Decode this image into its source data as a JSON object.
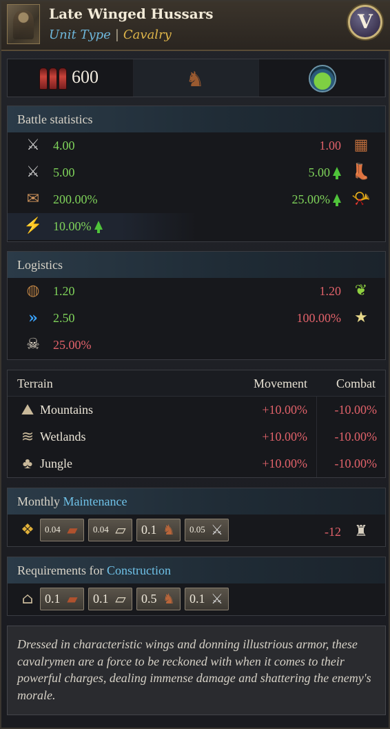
{
  "header": {
    "title": "Late Winged Hussars",
    "unit_type_label": "Unit Type",
    "unit_type_value": "Cavalry",
    "badge": "V"
  },
  "top": {
    "count": "600"
  },
  "battle": {
    "title": "Battle statistics",
    "rows": [
      {
        "left": "4.00",
        "right": "1.00",
        "left_icon": "melee-attack-icon",
        "right_icon": "armor-icon"
      },
      {
        "left": "5.00",
        "right": "5.00",
        "left_icon": "charge-attack-icon",
        "right_icon": "boot-speed-icon"
      },
      {
        "left": "200.00%",
        "right": "25.00%",
        "left_icon": "flank-icon",
        "right_icon": "horn-morale-icon"
      },
      {
        "left": "10.00%",
        "left_icon": "shock-icon"
      }
    ]
  },
  "logistics": {
    "title": "Logistics",
    "rows": [
      {
        "left": "1.20",
        "right": "1.20",
        "left_icon": "food-sack-icon",
        "right_icon": "supply-icon"
      },
      {
        "left": "2.50",
        "right": "100.00%",
        "left_icon": "movement-speed-icon",
        "right_icon": "star-upkeep-icon"
      },
      {
        "left": "25.00%",
        "left_icon": "skull-icon"
      }
    ]
  },
  "terrain": {
    "headers": {
      "name": "Terrain",
      "movement": "Movement",
      "combat": "Combat"
    },
    "rows": [
      {
        "name": "Mountains",
        "movement": "+10.00%",
        "combat": "-10.00%",
        "icon": "mountains-icon"
      },
      {
        "name": "Wetlands",
        "movement": "+10.00%",
        "combat": "-10.00%",
        "icon": "wetlands-icon"
      },
      {
        "name": "Jungle",
        "movement": "+10.00%",
        "combat": "-10.00%",
        "icon": "jungle-icon"
      }
    ]
  },
  "maintenance": {
    "title_prefix": "Monthly",
    "title_highlight": "Maintenance",
    "chips": [
      "0.04",
      "0.04",
      "0.1",
      "0.05"
    ],
    "manpower": "-12"
  },
  "construction": {
    "title_prefix": "Requirements for",
    "title_highlight": "Construction",
    "chips": [
      "0.1",
      "0.1",
      "0.5",
      "0.1"
    ]
  },
  "description": "Dressed in characteristic wings and donning illustrious armor, these cavalrymen are a force to be reckoned with when it comes to their powerful charges, dealing immense damage and shattering the enemy's morale.",
  "colors": {
    "positive": "#7fd35a",
    "negative": "#e2626a",
    "accent": "#6fc2e8",
    "gold": "#e0b64a"
  }
}
